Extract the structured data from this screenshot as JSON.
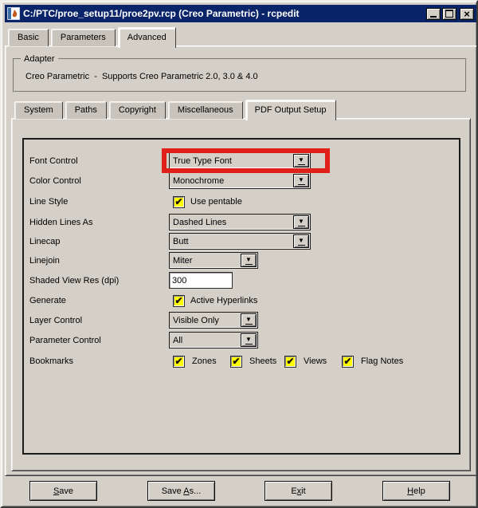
{
  "colors": {
    "titlebar": "#0a246a",
    "dialog_bg": "#d4d0c8",
    "annotation": "#e0201a",
    "checkbox_bg": "#ffff00",
    "check": "#1c0d05"
  },
  "icons": {
    "check": "✔",
    "dropdown_arrow": "▼",
    "close": "×"
  },
  "window": {
    "title": "C:/PTC/proe_setup11/proe2pv.rcp (Creo Parametric) - rcpedit"
  },
  "main_tabs": [
    {
      "label": "Basic",
      "selected": false
    },
    {
      "label": "Parameters",
      "selected": false
    },
    {
      "label": "Advanced",
      "selected": true
    }
  ],
  "adapter": {
    "legend": "Adapter",
    "text": "Creo Parametric  -  Supports Creo Parametric 2.0, 3.0 & 4.0"
  },
  "sub_tabs": [
    {
      "label": "System",
      "selected": false
    },
    {
      "label": "Paths",
      "selected": false
    },
    {
      "label": "Copyright",
      "selected": false
    },
    {
      "label": "Miscellaneous",
      "selected": false
    },
    {
      "label": "PDF Output Setup",
      "selected": true
    }
  ],
  "form": {
    "font_control": {
      "label": "Font Control",
      "value": "True Type Font"
    },
    "color_control": {
      "label": "Color Control",
      "value": "Monochrome"
    },
    "line_style": {
      "label": "Line Style",
      "checkbox": "Use pentable",
      "checked": true
    },
    "hidden_lines": {
      "label": "Hidden Lines As",
      "value": "Dashed Lines"
    },
    "linecap": {
      "label": "Linecap",
      "value": "Butt"
    },
    "linejoin": {
      "label": "Linejoin",
      "value": "Miter"
    },
    "shaded_res": {
      "label": "Shaded View Res (dpi)",
      "value": "300"
    },
    "generate": {
      "label": "Generate",
      "checkbox": "Active Hyperlinks",
      "checked": true
    },
    "layer_control": {
      "label": "Layer Control",
      "value": "Visible Only"
    },
    "parameter_control": {
      "label": "Parameter Control",
      "value": "All"
    },
    "bookmarks": {
      "label": "Bookmarks",
      "items": [
        {
          "label": "Zones",
          "checked": true
        },
        {
          "label": "Sheets",
          "checked": true
        },
        {
          "label": "Views",
          "checked": true
        },
        {
          "label": "Flag Notes",
          "checked": true
        }
      ]
    }
  },
  "buttons": [
    {
      "pre": "",
      "u": "S",
      "post": "ave"
    },
    {
      "pre": "Save ",
      "u": "A",
      "post": "s..."
    },
    {
      "pre": "E",
      "u": "x",
      "post": "it"
    },
    {
      "pre": "",
      "u": "H",
      "post": "elp"
    }
  ]
}
